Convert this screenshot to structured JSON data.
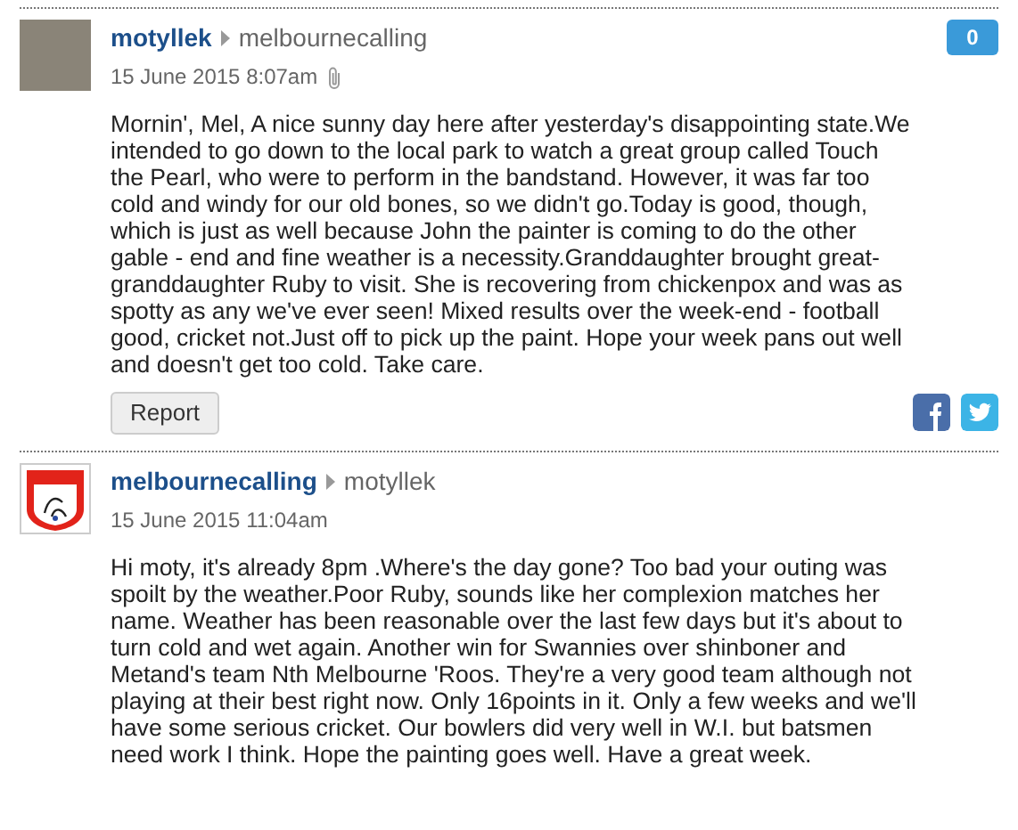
{
  "posts": [
    {
      "kind": "photo",
      "author": "motyllek",
      "recipient": "melbournecalling",
      "date": "15 June 2015 8:07am",
      "has_attachment": true,
      "count": "0",
      "body": "Mornin', Mel, A nice sunny day here after yesterday's disappointing state.We intended to go down to the local park to watch a great group called Touch the Pearl, who were to perform in the bandstand. However, it was far too cold and windy for our old bones, so we didn't go.Today is good, though, which is just as well because John the painter is coming to do the other gable - end and fine weather is a necessity.Granddaughter brought great-granddaughter Ruby to visit. She is recovering from chickenpox and was as spotty as any we've ever seen! Mixed results over the week-end - football good, cricket not.Just off to pick up the paint. Hope your week pans out well and doesn't get too cold. Take care.",
      "report_label": "Report",
      "share": true
    },
    {
      "kind": "logo",
      "author": "melbournecalling",
      "recipient": "motyllek",
      "date": "15 June 2015 11:04am",
      "has_attachment": false,
      "body": "Hi moty, it's already 8pm .Where's the day gone? Too bad your outing was spoilt by the weather.Poor Ruby, sounds like her complexion matches her name. Weather has been reasonable over the last few days but it's about to turn cold and wet again. Another win for Swannies over shinboner and Metand's team Nth Melbourne 'Roos. They're a very good team although not playing at their best right now. Only 16points in it. Only a few weeks and we'll have some serious cricket. Our bowlers did very well in W.I. but batsmen need work I think. Hope the painting goes well. Have a great week.",
      "share": false
    }
  ]
}
